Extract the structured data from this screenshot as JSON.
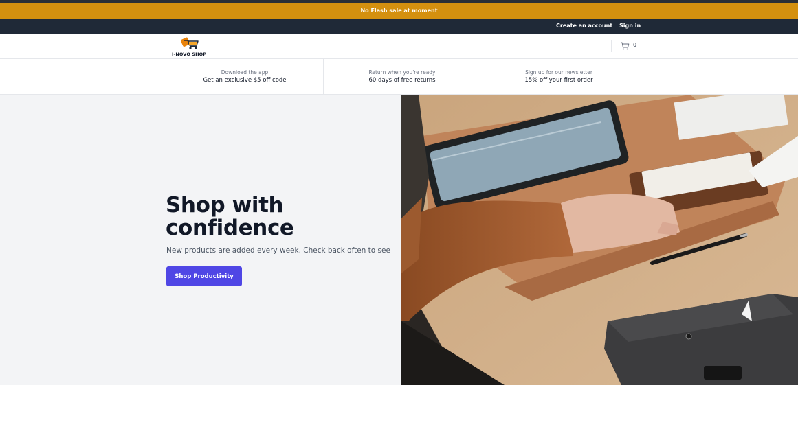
{
  "flash_bar": {
    "text": "No Flash sale at moment"
  },
  "account_bar": {
    "create_account": "Create an account",
    "sign_in": "Sign in"
  },
  "navbar": {
    "logo_text": "I-NOVO SHOP",
    "cart_count": "0",
    "cart_icon": "shopping-cart-icon"
  },
  "perks": [
    {
      "label": "Download the app",
      "value": "Get an exclusive $5 off code"
    },
    {
      "label": "Return when you're ready",
      "value": "60 days of free returns"
    },
    {
      "label": "Sign up for our newsletter",
      "value": "15% off your first order"
    }
  ],
  "hero": {
    "title_line1": "Shop with",
    "title_line2": "confidence",
    "subtitle": "New products are added every week. Check back often to see",
    "button_label": "Shop Productivity",
    "image_description_icon": "hero-photo"
  },
  "colors": {
    "flash": "#d4900f",
    "dark_bar": "#1f2937",
    "accent": "#4f46e5",
    "hero_bg": "#f3f4f6"
  }
}
